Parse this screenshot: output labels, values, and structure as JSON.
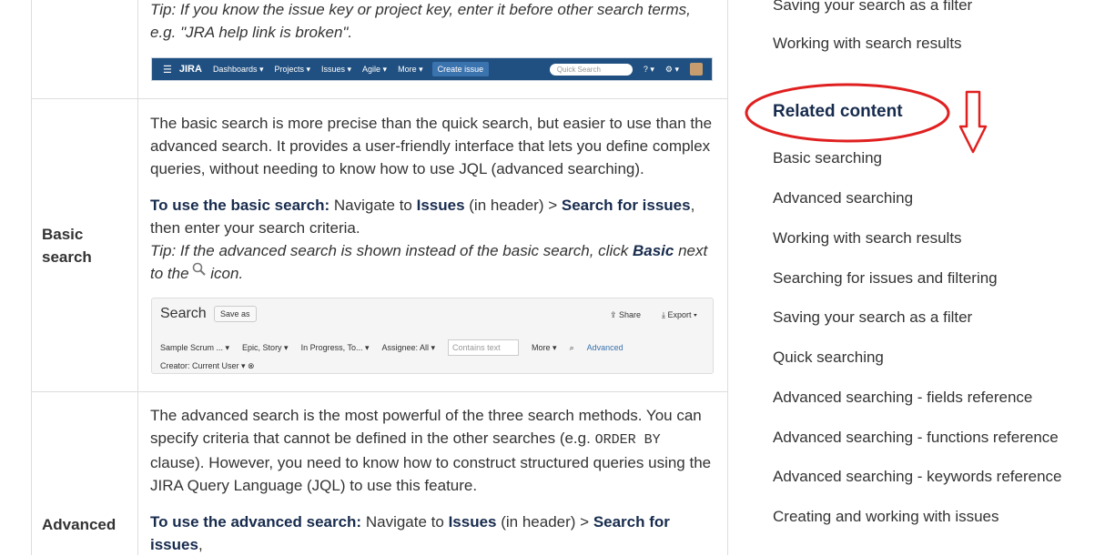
{
  "table": {
    "row0": {
      "tip": "Tip: If you know the issue key or project key, enter it before other search terms, e.g. \"JRA help link is broken\"."
    },
    "jira_header": {
      "logo": "JIRA",
      "nav": [
        "Dashboards ▾",
        "Projects ▾",
        "Issues ▾",
        "Agile ▾",
        "More ▾"
      ],
      "create": "Create issue",
      "quick_search": "Quick Search"
    },
    "basic": {
      "label": "Basic search",
      "desc": "The basic search is more precise than the quick search, but easier to use than the advanced search. It provides a user-friendly interface that lets you define complex queries, without needing to know how to use JQL (advanced searching).",
      "howto_bold": "To use the basic search:",
      "howto_1": " Navigate to ",
      "issues": "Issues",
      "howto_2": " (in header) > ",
      "search_for_issues": "Search for issues",
      "howto_3": ", then enter your search criteria.",
      "tip_1": "Tip: If the advanced search is shown instead of the basic search, click ",
      "tip_basic": "Basic",
      "tip_2": " next to the",
      "tip_3": " icon."
    },
    "search_shot": {
      "title": "Search",
      "save_as": "Save as",
      "share": "⇪ Share",
      "export": "⤓ Export ▾",
      "filters": [
        "Sample Scrum ... ▾",
        "Epic, Story ▾",
        "In Progress, To... ▾",
        "Assignee: All ▾"
      ],
      "contains_placeholder": "Contains text",
      "more": "More ▾",
      "advanced": "Advanced",
      "creator": "Creator: Current User ▾ ⊗"
    },
    "advanced": {
      "label": "Advanced",
      "desc_1": "The advanced search is the most powerful of the three search methods. You can specify criteria that cannot be defined in the other searches (e.g. ",
      "code": "ORDER BY",
      "desc_2": " clause). However, you need to know how to construct structured queries using the JIRA Query Language (JQL) to use this feature.",
      "howto_bold": "To use the advanced search:",
      "howto_1": " Navigate to ",
      "issues": "Issues",
      "howto_2": " (in header) > ",
      "search_for_issues": "Search for issues",
      "howto_3": ","
    }
  },
  "sidebar": {
    "top_items": [
      "Saving your search as a filter",
      "Working with search results"
    ],
    "related_heading": "Related content",
    "related_items": [
      "Basic searching",
      "Advanced searching",
      "Working with search results",
      "Searching for issues and filtering",
      "Saving your search as a filter",
      "Quick searching",
      "Advanced searching - fields reference",
      "Advanced searching - functions reference",
      "Advanced searching - keywords reference",
      "Creating and working with issues"
    ]
  },
  "colors": {
    "annotation": "#e02020",
    "jira_bar": "#205081",
    "link_text": "#333333"
  }
}
